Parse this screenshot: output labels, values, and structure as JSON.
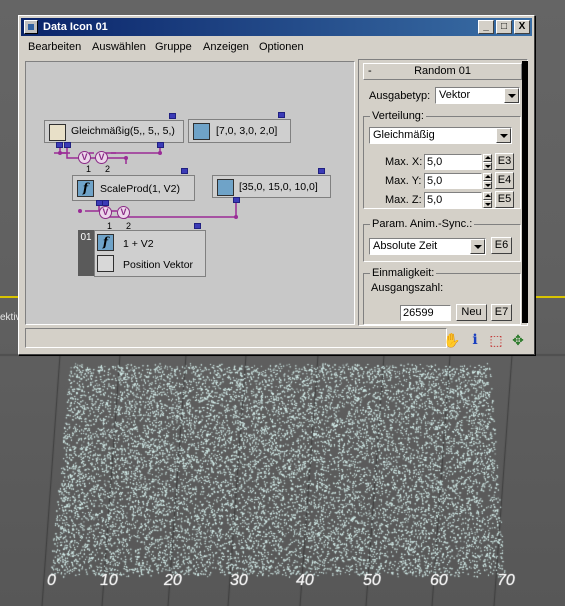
{
  "window": {
    "title": "Data Icon 01",
    "icon": "data-icon"
  },
  "titlebar_buttons": {
    "minimize": "_",
    "maximize": "□",
    "close": "X"
  },
  "menu": [
    "Bearbeiten",
    "Auswählen",
    "Gruppe",
    "Anzeigen",
    "Optionen"
  ],
  "schematic": {
    "nodes": {
      "random": {
        "label": "Gleichmäßig(5,, 5,, 5,)",
        "icon": "dice-icon"
      },
      "vector1": {
        "label": "[7,0, 3,0, 2,0]",
        "icon": "vector-arrow-icon"
      },
      "scaleprod": {
        "label": "ScaleProd(1, V2)",
        "icon": "function-icon"
      },
      "vector2": {
        "label": "[35,0, 15,0, 10,0]",
        "icon": "vector-arrow-icon"
      },
      "output": {
        "index": "01",
        "func_label": "1 + V2",
        "out_label": "Position Vektor",
        "icons": [
          "function-icon",
          "position-output-icon"
        ]
      }
    },
    "connector_label": "V",
    "wire_labels": [
      "1",
      "2",
      "1",
      "2"
    ],
    "wire_color": "#9a2b96",
    "pin_color": "#3b3bb7"
  },
  "panel": {
    "rollout_title": "Random 01",
    "rollout_toggle": "-",
    "ausgabetyp": {
      "label": "Ausgabetyp:",
      "value": "Vektor"
    },
    "verteilung": {
      "title": "Verteilung:",
      "value": "Gleichmäßig",
      "rows": [
        {
          "label": "Max. X:",
          "value": "5,0",
          "button": "E3"
        },
        {
          "label": "Max. Y:",
          "value": "5,0",
          "button": "E4"
        },
        {
          "label": "Max. Z:",
          "value": "5,0",
          "button": "E5"
        }
      ]
    },
    "sync": {
      "title": "Param. Anim.-Sync.:",
      "value": "Absolute Zeit",
      "button": "E6"
    },
    "einmaligkeit": {
      "title": "Einmaligkeit:",
      "seed_label": "Ausgangszahl:",
      "seed_value": "26599",
      "new_button": "Neu",
      "button": "E7"
    }
  },
  "status_icons": [
    "hand-pan-icon",
    "info-icon",
    "region-select-icon",
    "move-gizmo-icon"
  ],
  "status_glyphs": {
    "hand": "✋",
    "info": "i",
    "region": "⬚",
    "move": "✥"
  },
  "viewport": {
    "label": "ektiv",
    "axis_ticks": [
      "0",
      "10",
      "20",
      "30",
      "40",
      "50",
      "60",
      "70"
    ],
    "particle_color": "#d8f3f0",
    "horizon_color": "#d8c400"
  }
}
